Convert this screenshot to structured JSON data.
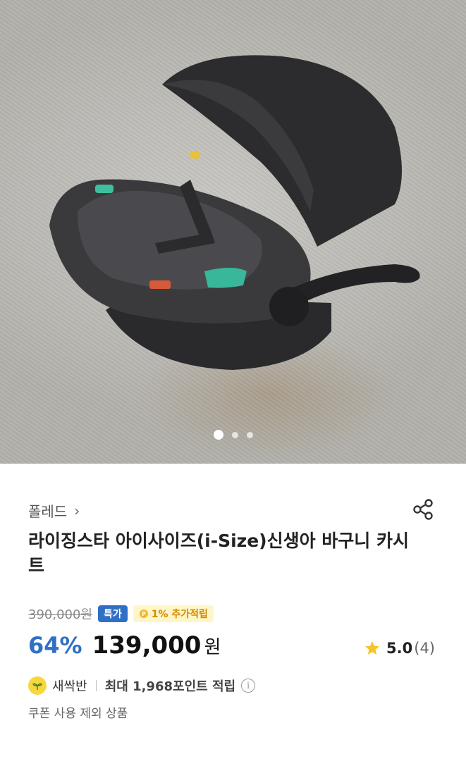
{
  "product_image": {
    "icon": "infant-car-seat-photo",
    "carousel": {
      "count": 3,
      "active": 1
    }
  },
  "brand": {
    "name": "폴레드",
    "chevron": "›"
  },
  "product": {
    "title": "라이징스타 아이사이즈(i-Size)신생아 바구니 카시트"
  },
  "pricing": {
    "original_price": "390,000원",
    "sale_badge": "특가",
    "point_badge": "1% 추가적립",
    "discount_rate": "64%",
    "price": "139,000",
    "currency": "원"
  },
  "rating": {
    "score": "5.0",
    "count": "(4)"
  },
  "points": {
    "tier": "새싹반",
    "info": "최대 1,968포인트 적립"
  },
  "coupon_note": "쿠폰 사용 제외 상품",
  "colors": {
    "accent_blue": "#2f6fc6",
    "star": "#f6c329",
    "point_badge_text": "#d48a00",
    "point_badge_bg": "#fff6c8"
  }
}
